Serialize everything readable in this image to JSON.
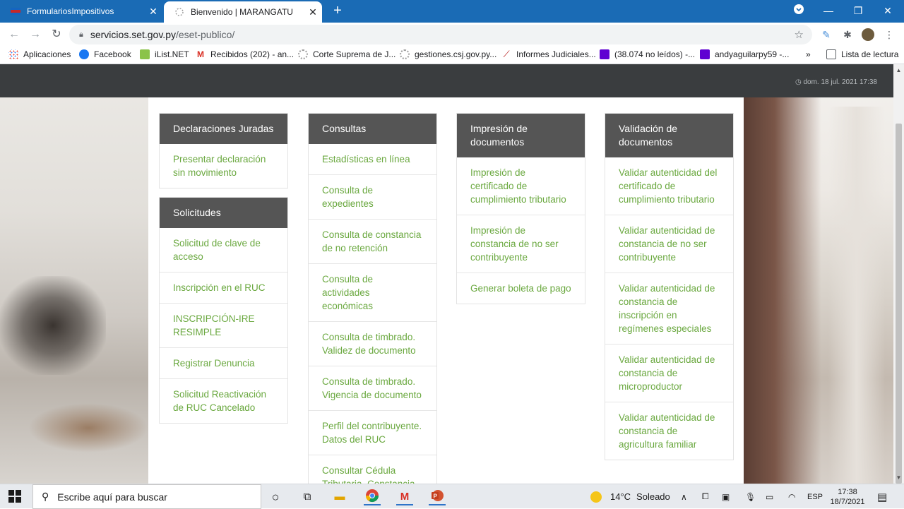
{
  "browser": {
    "tabs": [
      {
        "title": "FormulariosImpositivos",
        "active": false
      },
      {
        "title": "Bienvenido | MARANGATU",
        "active": true
      }
    ],
    "url_host": "servicios.set.gov.py",
    "url_path": "/eset-publico/",
    "bookmarks": [
      {
        "label": "Aplicaciones",
        "color": "#4285f4"
      },
      {
        "label": "Facebook",
        "color": "#1877f2"
      },
      {
        "label": "iList.NET",
        "color": "#8bc34a"
      },
      {
        "label": "Recibidos (202) - an...",
        "color": "#d93025"
      },
      {
        "label": "Corte Suprema de J...",
        "color": "#9e9e9e"
      },
      {
        "label": "gestiones.csj.gov.py...",
        "color": "#9e9e9e"
      },
      {
        "label": "Informes Judiciales...",
        "color": "#b71c1c"
      },
      {
        "label": "(38.074 no leídos) -...",
        "color": "#6001d2"
      },
      {
        "label": "andyaguilarpy59 -...",
        "color": "#6001d2"
      }
    ],
    "more_bookmarks": "»",
    "reading_list": "Lista de lectura"
  },
  "page": {
    "datetime": "dom. 18 jul. 2021 17:38",
    "columns": [
      {
        "panels": [
          {
            "title": "Declaraciones Juradas",
            "links": [
              "Presentar declaración sin movimiento"
            ]
          },
          {
            "title": "Solicitudes",
            "links": [
              "Solicitud de clave de acceso",
              "Inscripción en el RUC",
              "INSCRIPCIÓN-IRE RESIMPLE",
              "Registrar Denuncia",
              "Solicitud Reactivación de RUC Cancelado"
            ]
          }
        ]
      },
      {
        "panels": [
          {
            "title": "Consultas",
            "links": [
              "Estadísticas en línea",
              "Consulta de expedientes",
              "Consulta de constancia de no retención",
              "Consulta de actividades económicas",
              "Consulta de timbrado. Validez de documento",
              "Consulta de timbrado. Vigencia de documento",
              "Perfil del contribuyente. Datos del RUC",
              "Consultar Cédula Tributaria, Constancia de RUC"
            ]
          }
        ]
      },
      {
        "panels": [
          {
            "title": "Impresión de documentos",
            "links": [
              "Impresión de certificado de cumplimiento tributario",
              "Impresión de constancia de no ser contribuyente",
              "Generar boleta de pago"
            ]
          }
        ]
      },
      {
        "panels": [
          {
            "title": "Validación de documentos",
            "links": [
              "Validar autenticidad del certificado de cumplimiento tributario",
              "Validar autenticidad de constancia de no ser contribuyente",
              "Validar autenticidad de constancia de inscripción en regímenes especiales",
              "Validar autenticidad de constancia de microproductor",
              "Validar autenticidad de constancia de agricultura familiar"
            ]
          }
        ]
      }
    ]
  },
  "taskbar": {
    "search_placeholder": "Escribe aquí para buscar",
    "weather_temp": "14°C",
    "weather_text": "Soleado",
    "language": "ESP",
    "time": "17:38",
    "date": "18/7/2021"
  }
}
